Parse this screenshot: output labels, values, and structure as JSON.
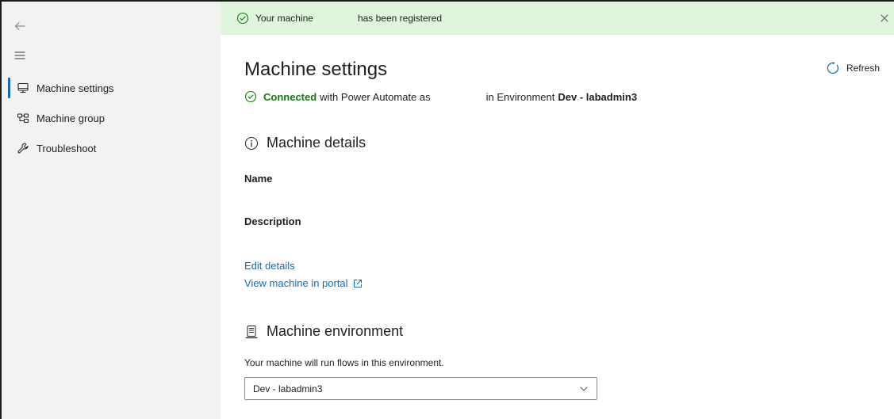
{
  "sidebar": {
    "items": [
      {
        "label": "Machine settings",
        "icon": "monitor-icon",
        "active": true
      },
      {
        "label": "Machine group",
        "icon": "machine-group-icon",
        "active": false
      },
      {
        "label": "Troubleshoot",
        "icon": "wrench-icon",
        "active": false
      }
    ]
  },
  "banner": {
    "text_part1": "Your machine",
    "text_part2": "has been registered",
    "icon": "check-circle-icon",
    "close_icon": "close-icon"
  },
  "header": {
    "title": "Machine settings",
    "refresh_label": "Refresh"
  },
  "status": {
    "connected": "Connected",
    "middle_text": "with Power Automate as",
    "env_prefix": "in Environment",
    "env_name": "Dev - labadmin3"
  },
  "details": {
    "section_title": "Machine details",
    "name_label": "Name",
    "description_label": "Description",
    "edit_link": "Edit details",
    "view_link": "View machine in portal"
  },
  "environment": {
    "section_title": "Machine environment",
    "hint": "Your machine will run flows in this environment.",
    "selected": "Dev - labadmin3"
  },
  "colors": {
    "accent": "#0f6cbd",
    "success": "#107c10",
    "banner_bg": "#dff6dd",
    "sidebar_bg": "#f3f2f1"
  }
}
